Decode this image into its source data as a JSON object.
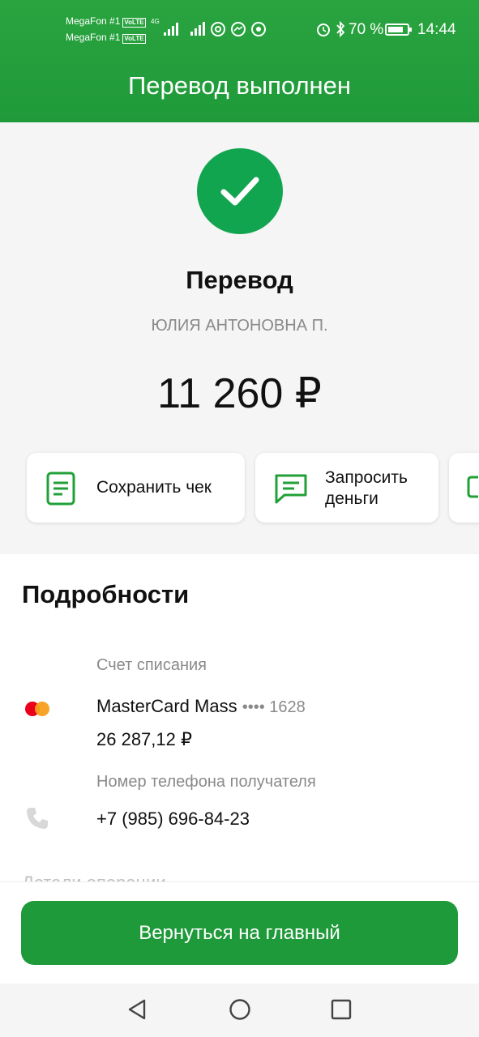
{
  "status_bar": {
    "operator1": "MegaFon #1",
    "operator2": "MegaFon #1",
    "volte": "VoLTE",
    "network": "4G",
    "battery": "70 %",
    "time": "14:44",
    "icons": [
      "signal-icon",
      "at-icon",
      "messenger-icon",
      "whatsapp-icon",
      "alarm-icon",
      "bluetooth-icon",
      "battery-icon"
    ]
  },
  "header": {
    "title": "Перевод выполнен"
  },
  "result": {
    "title": "Перевод",
    "recipient": "ЮЛИЯ АНТОНОВНА П.",
    "amount": "11 260 ₽",
    "success_color": "#12a550"
  },
  "actions": [
    {
      "label": "Сохранить чек",
      "icon": "receipt-icon"
    },
    {
      "label": "Запросить деньги",
      "icon": "message-icon"
    },
    {
      "label": "",
      "icon": "chat-icon"
    }
  ],
  "details": {
    "title": "Подробности",
    "account_label": "Счет списания",
    "card_name": "MasterCard Mass",
    "card_mask": "•••• 1628",
    "balance": "26 287,12 ₽",
    "phone_label": "Номер телефона получателя",
    "phone": "+7 (985) 696-84-23",
    "next_section": "Детали операции"
  },
  "bottom": {
    "home_button": "Вернуться на главный"
  },
  "colors": {
    "brand": "#1f9a3a",
    "accent": "#21a038"
  }
}
